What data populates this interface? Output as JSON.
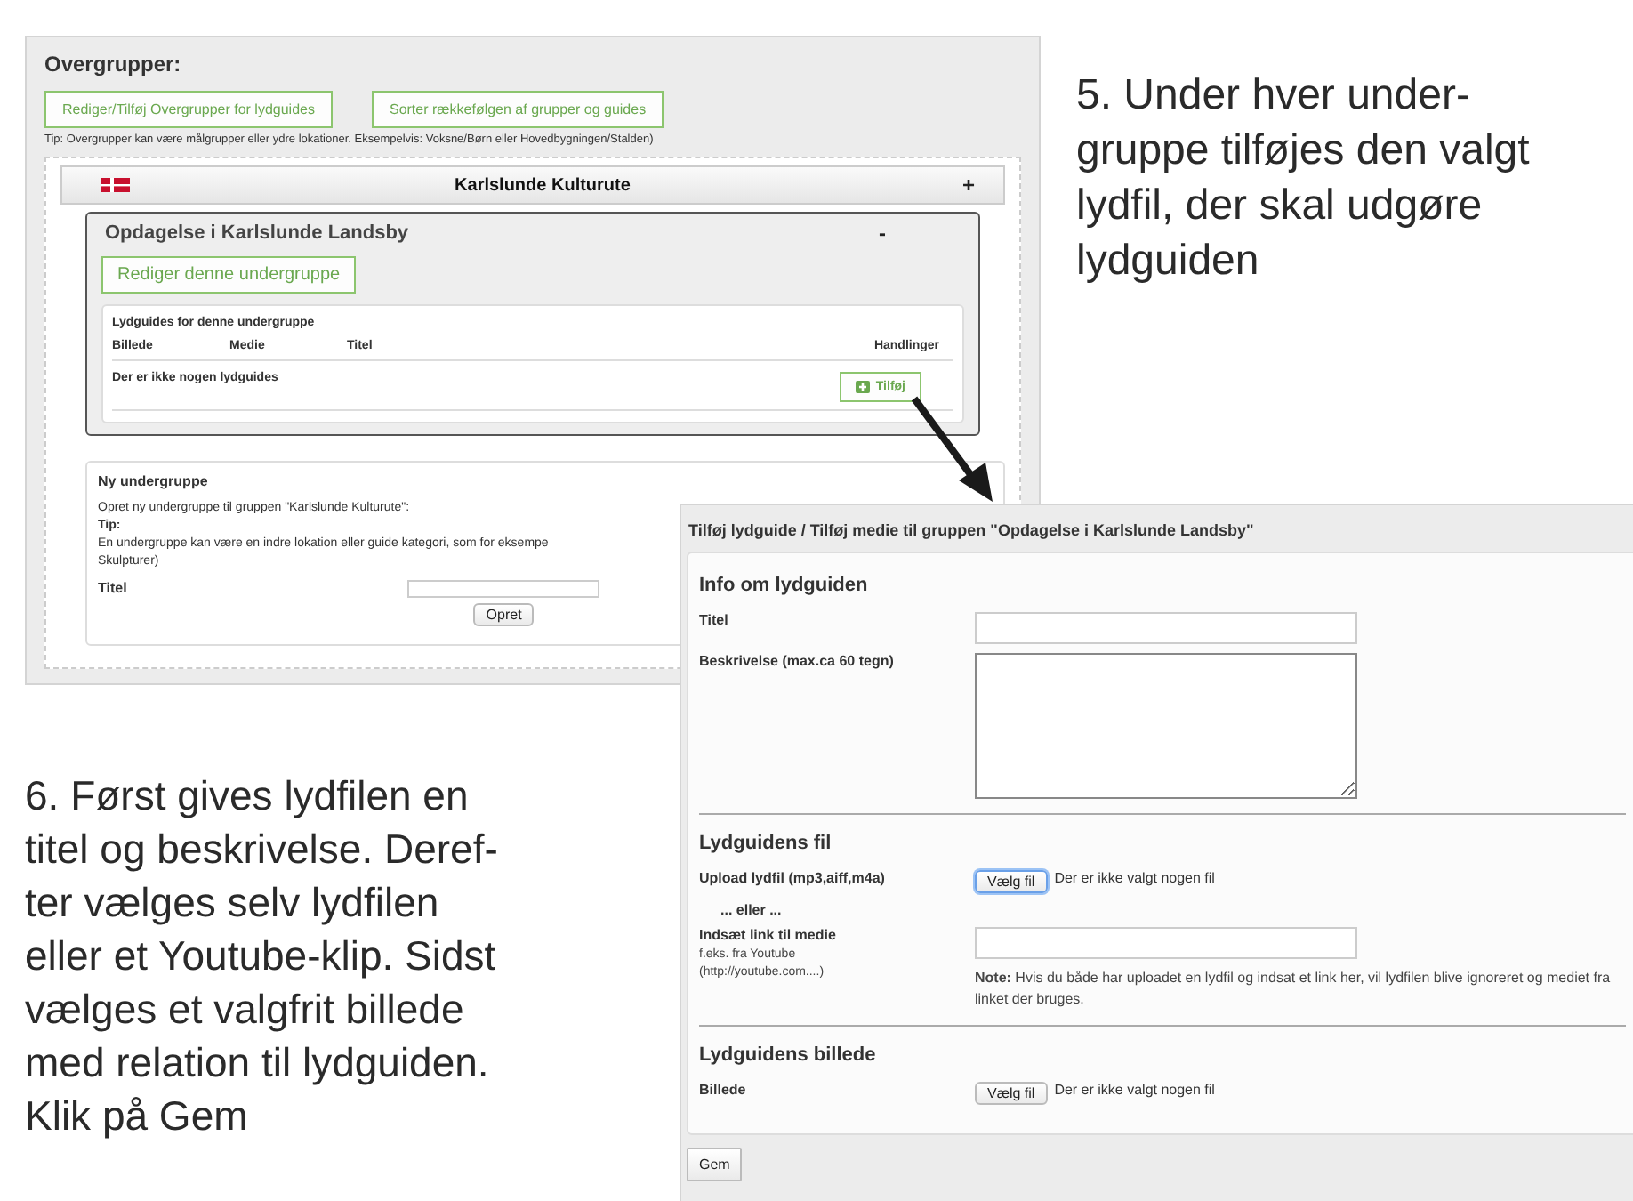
{
  "overview_screen": {
    "heading": "Overgrupper:",
    "buttons": [
      "Rediger/Tilføj Overgrupper for lydguides",
      "Sorter rækkefølgen af grupper og guides"
    ],
    "tip": "Tip: Overgrupper kan være målgrupper eller ydre lokationer. Eksempelvis: Voksne/Børn eller Hovedbygningen/Stalden)",
    "group": {
      "title": "Karlslunde Kulturute",
      "toggle": "+"
    },
    "subgroup": {
      "title": "Opdagelse i Karlslunde Landsby",
      "toggle": "-",
      "edit_button": "Rediger denne undergruppe",
      "table_title": "Lydguides for denne undergruppe",
      "columns": [
        "Billede",
        "Medie",
        "Titel",
        "Handlinger"
      ],
      "empty_text": "Der er ikke nogen lydguides",
      "add_button": "Tilføj"
    },
    "new_subgroup": {
      "heading": "Ny undergruppe",
      "intro": "Opret ny undergruppe til gruppen \"Karlslunde Kulturute\":",
      "tip_label": "Tip:",
      "tip_lines": [
        "En undergruppe kan være en indre lokation eller guide kategori, som for eksempe",
        "Skulpturer)"
      ],
      "title_label": "Titel",
      "create_button": "Opret"
    }
  },
  "dialog": {
    "title": "Tilføj lydguide / Tilføj medie til gruppen \"Opdagelse i Karlslunde Landsby\"",
    "sections": [
      {
        "heading": "Info om lydguiden",
        "rows": [
          {
            "kind": "text",
            "label": "Titel"
          },
          {
            "kind": "textarea",
            "label": "Beskrivelse (max.ca 60 tegn)"
          }
        ]
      },
      {
        "heading": "Lydguidens fil",
        "rows": [
          {
            "kind": "file",
            "label": "Upload lydfil (mp3,aiff,m4a)",
            "button": "Vælg fil",
            "status": "Der er ikke valgt nogen fil",
            "focused": true
          },
          {
            "kind": "or",
            "label": "... eller ..."
          },
          {
            "kind": "link",
            "label": "Indsæt link til medie",
            "hints": [
              "f.eks. fra Youtube",
              "(http://youtube.com....)"
            ],
            "note": "**Note:** Hvis du både har uploadet en lydfil og indsat et link her, vil lydfilen blive ignoreret og mediet fra linket der bruges."
          }
        ]
      },
      {
        "heading": "Lydguidens billede",
        "rows": [
          {
            "kind": "file",
            "label": "Billede",
            "button": "Vælg fil",
            "status": "Der er ikke valgt nogen fil",
            "focused": false
          }
        ]
      }
    ],
    "save_button": "Gem"
  },
  "captions": [
    {
      "lines": [
        "5. Under hver under-",
        "gruppe tilføjes den valgt",
        "lydfil, der skal udgøre",
        "lydguiden"
      ]
    },
    {
      "lines": [
        "6. Først gives lydfilen en",
        "titel og beskrivelse. Deref-",
        "ter vælges selv lydfilen",
        "eller et Youtube-klip. Sidst",
        "vælges et valgfrit billede",
        "med relation til lydguiden.",
        "Klik på Gem"
      ]
    }
  ]
}
